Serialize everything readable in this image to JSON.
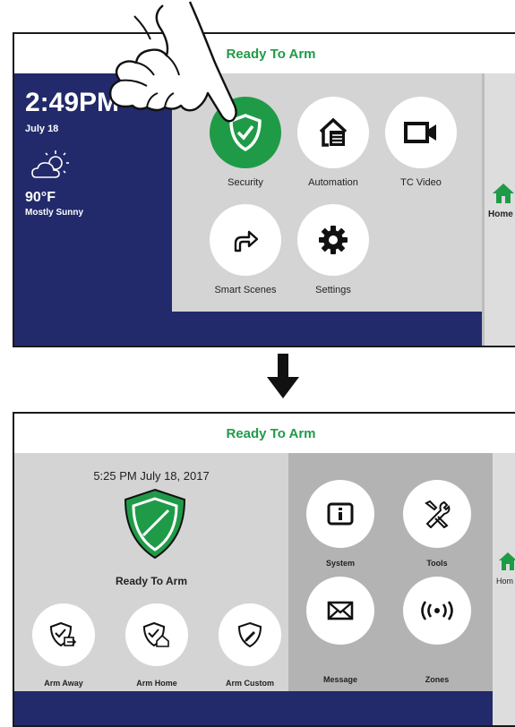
{
  "before": {
    "status": "Ready To Arm",
    "time": "2:49PM",
    "date": "July 18",
    "temperature": "90°F",
    "weather": "Mostly Sunny",
    "tiles": [
      {
        "label": "Security",
        "icon": "shield-check-icon"
      },
      {
        "label": "Automation",
        "icon": "home-automation-icon"
      },
      {
        "label": "TC Video",
        "icon": "video-camera-icon"
      },
      {
        "label": "Smart Scenes",
        "icon": "arrow-up-right-icon"
      },
      {
        "label": "Settings",
        "icon": "gear-icon"
      }
    ],
    "side_label": "Home"
  },
  "after": {
    "status": "Ready To Arm",
    "datetime": "5:25 PM July 18, 2017",
    "shield_status": "Ready To Arm",
    "arm_buttons": [
      {
        "label": "Arm Away",
        "icon": "arm-away-icon"
      },
      {
        "label": "Arm Home",
        "icon": "arm-home-icon"
      },
      {
        "label": "Arm Custom",
        "icon": "arm-custom-icon"
      }
    ],
    "tools": [
      {
        "label": "System",
        "icon": "info-icon"
      },
      {
        "label": "Tools",
        "icon": "tools-icon"
      },
      {
        "label": "Message",
        "icon": "envelope-icon"
      },
      {
        "label": "Zones",
        "icon": "wireless-zones-icon"
      }
    ],
    "side_label": "Hom"
  },
  "colors": {
    "accent_green": "#1f9b48",
    "navy": "#222a6b",
    "panel_gray": "#d4d4d4",
    "dark_gray": "#b3b3b3"
  }
}
